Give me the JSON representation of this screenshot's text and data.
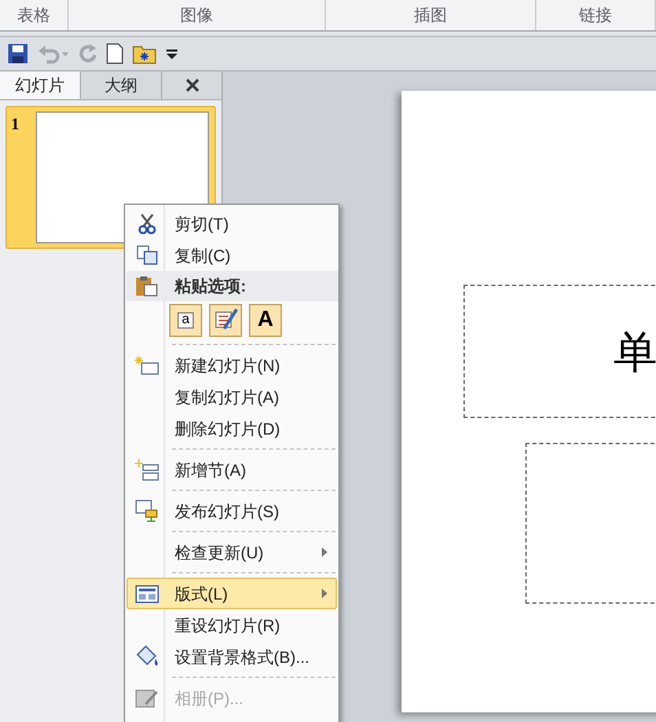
{
  "ribbon_groups": [
    "表格",
    "图像",
    "插图",
    "链接"
  ],
  "pane_tabs": [
    {
      "label": "幻灯片",
      "selected": true
    },
    {
      "label": "大纲",
      "selected": false
    }
  ],
  "thumbnails": [
    {
      "number": "1",
      "selected": true
    }
  ],
  "slide": {
    "title": "单"
  },
  "context_menu": [
    {
      "kind": "item",
      "label": "剪切(T)",
      "selected": false,
      "disabled": false,
      "submenu": false
    },
    {
      "kind": "item",
      "label": "复制(C)",
      "selected": false,
      "disabled": false,
      "submenu": false
    },
    {
      "kind": "header",
      "label": "粘贴选项:"
    },
    {
      "kind": "paste_options",
      "options": [
        {
          "kind": "keep_formatting",
          "label": "a"
        },
        {
          "kind": "theme"
        },
        {
          "kind": "text_only",
          "label": "A"
        }
      ]
    },
    {
      "kind": "separator"
    },
    {
      "kind": "item",
      "label": "新建幻灯片(N)",
      "selected": false,
      "disabled": false,
      "submenu": false
    },
    {
      "kind": "item",
      "label": "复制幻灯片(A)",
      "selected": false,
      "disabled": false,
      "submenu": false
    },
    {
      "kind": "item",
      "label": "删除幻灯片(D)",
      "selected": false,
      "disabled": false,
      "submenu": false
    },
    {
      "kind": "separator"
    },
    {
      "kind": "item",
      "label": "新增节(A)",
      "selected": false,
      "disabled": false,
      "submenu": false
    },
    {
      "kind": "separator"
    },
    {
      "kind": "item",
      "label": "发布幻灯片(S)",
      "selected": false,
      "disabled": false,
      "submenu": false
    },
    {
      "kind": "separator"
    },
    {
      "kind": "item",
      "label": "检查更新(U)",
      "selected": false,
      "disabled": false,
      "submenu": true
    },
    {
      "kind": "separator"
    },
    {
      "kind": "item",
      "label": "版式(L)",
      "selected": true,
      "disabled": false,
      "submenu": true
    },
    {
      "kind": "item",
      "label": "重设幻灯片(R)",
      "selected": false,
      "disabled": false,
      "submenu": false
    },
    {
      "kind": "item",
      "label": "设置背景格式(B)...",
      "selected": false,
      "disabled": false,
      "submenu": false
    },
    {
      "kind": "separator"
    },
    {
      "kind": "item",
      "label": "相册(P)...",
      "selected": false,
      "disabled": true,
      "submenu": false
    }
  ]
}
